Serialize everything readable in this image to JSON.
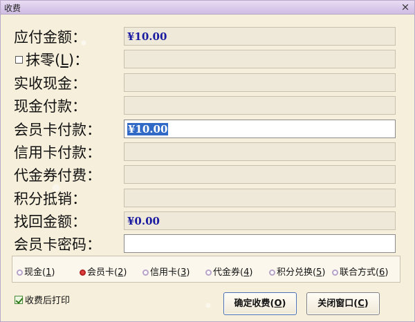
{
  "window": {
    "title": "收费",
    "close_glyph": "×"
  },
  "fields": [
    {
      "label": "应付金额：",
      "value": "¥10.00",
      "state": "readonly"
    },
    {
      "label_prefix": "抹零(",
      "label_key": "L",
      "label_suffix": ")：",
      "value": "",
      "state": "readonly",
      "checkbox": true
    },
    {
      "label": "实收现金：",
      "value": "",
      "state": "readonly"
    },
    {
      "label": "现金付款：",
      "value": "",
      "state": "readonly"
    },
    {
      "label": "会员卡付款：",
      "value": "¥10.00",
      "state": "active"
    },
    {
      "label": "信用卡付款：",
      "value": "",
      "state": "readonly"
    },
    {
      "label": "代金券付费：",
      "value": "",
      "state": "readonly"
    },
    {
      "label": "积分抵销：",
      "value": "",
      "state": "readonly"
    },
    {
      "label": "找回金额：",
      "value": "¥0.00",
      "state": "readonly"
    },
    {
      "label": "会员卡密码：",
      "value": "",
      "state": "editable"
    }
  ],
  "payment_methods": [
    {
      "label": "现金",
      "key": "1",
      "selected": false
    },
    {
      "label": "会员卡",
      "key": "2",
      "selected": true
    },
    {
      "label": "信用卡",
      "key": "3",
      "selected": false
    },
    {
      "label": "代金券",
      "key": "4",
      "selected": false
    },
    {
      "label": "积分兑换",
      "key": "5",
      "selected": false
    },
    {
      "label": "联合方式",
      "key": "6",
      "selected": false
    }
  ],
  "print_after_charge": {
    "label": "收费后打印",
    "checked": true
  },
  "buttons": {
    "confirm": {
      "label": "确定收费(",
      "key": "O",
      "suffix": ")"
    },
    "close": {
      "label": "关闭窗口(",
      "key": "C",
      "suffix": ")"
    }
  },
  "colors": {
    "value_text": "#1a1aa0",
    "selection": "#3169c6",
    "titlebar": "#d9c8ea"
  }
}
